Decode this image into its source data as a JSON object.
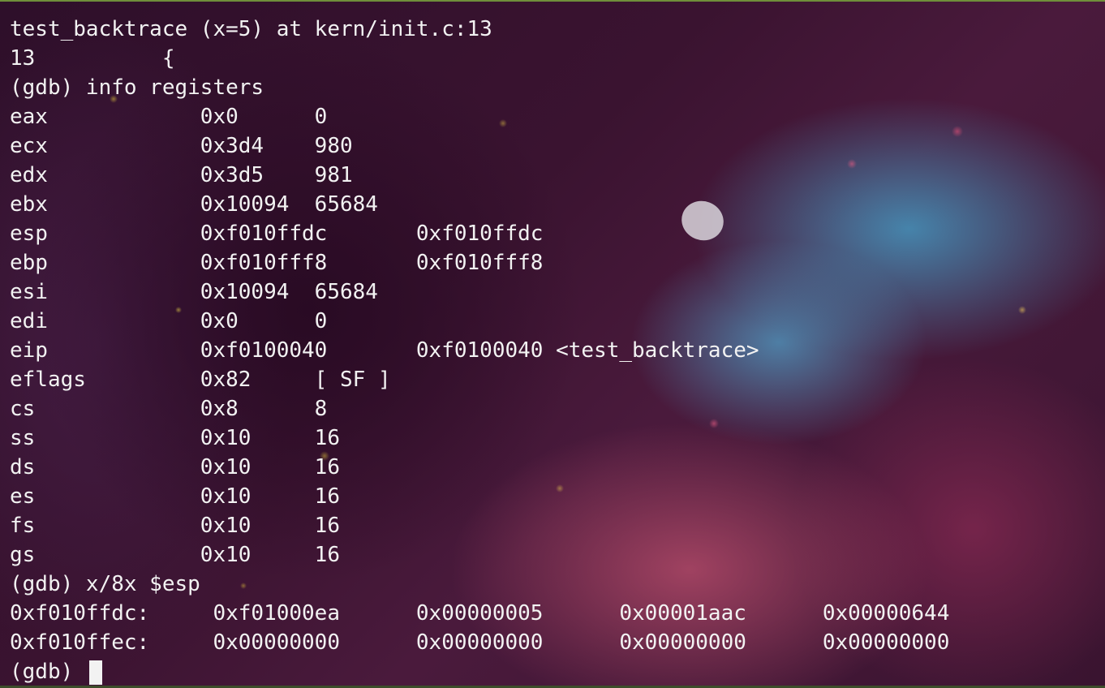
{
  "terminal": {
    "lines": [
      "test_backtrace (x=5) at kern/init.c:13",
      "13\t    {",
      "(gdb) info registers",
      "eax            0x0      0",
      "ecx            0x3d4    980",
      "edx            0x3d5    981",
      "ebx            0x10094  65684",
      "esp            0xf010ffdc       0xf010ffdc",
      "ebp            0xf010fff8       0xf010fff8",
      "esi            0x10094  65684",
      "edi            0x0      0",
      "eip            0xf0100040       0xf0100040 <test_backtrace>",
      "eflags         0x82     [ SF ]",
      "cs             0x8      8",
      "ss             0x10     16",
      "ds             0x10     16",
      "es             0x10     16",
      "fs             0x10     16",
      "gs             0x10     16",
      "(gdb) x/8x $esp",
      "0xf010ffdc:     0xf01000ea      0x00000005      0x00001aac      0x00000644",
      "0xf010ffec:     0x00000000      0x00000000      0x00000000      0x00000000"
    ],
    "prompt": "(gdb) "
  }
}
